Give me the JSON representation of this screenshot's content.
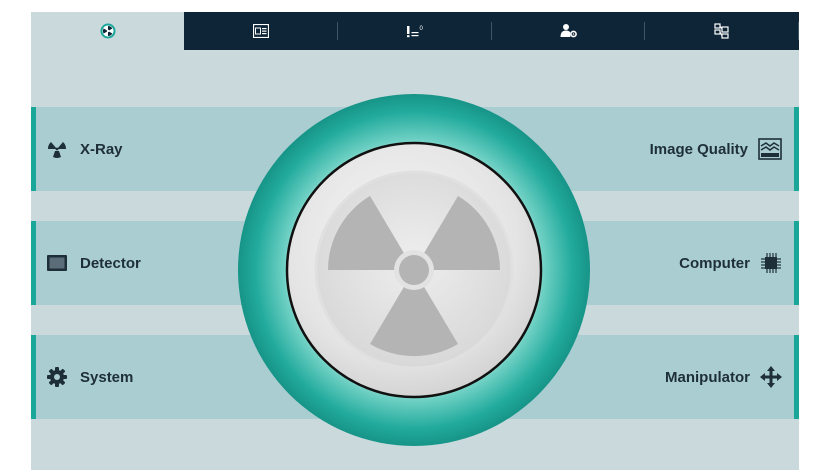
{
  "tabs": [
    {
      "icon": "radiation-icon",
      "active": true
    },
    {
      "icon": "image-document-icon",
      "active": false
    },
    {
      "icon": "parameter-list-icon",
      "active": false
    },
    {
      "icon": "user-settings-icon",
      "active": false
    },
    {
      "icon": "network-diagram-icon",
      "active": false
    }
  ],
  "left_menu": [
    {
      "label": "X-Ray",
      "icon": "radiation-small-icon"
    },
    {
      "label": "Detector",
      "icon": "detector-panel-icon"
    },
    {
      "label": "System",
      "icon": "gear-icon"
    }
  ],
  "right_menu": [
    {
      "label": "Image Quality",
      "icon": "image-quality-icon"
    },
    {
      "label": "Computer",
      "icon": "cpu-chip-icon"
    },
    {
      "label": "Manipulator",
      "icon": "move-arrows-icon"
    }
  ],
  "colors": {
    "accent": "#1aa79a",
    "tabbar": "#0d2537",
    "background": "#c9d9dc",
    "row": "#aacdd1",
    "text": "#1e2f3a"
  }
}
